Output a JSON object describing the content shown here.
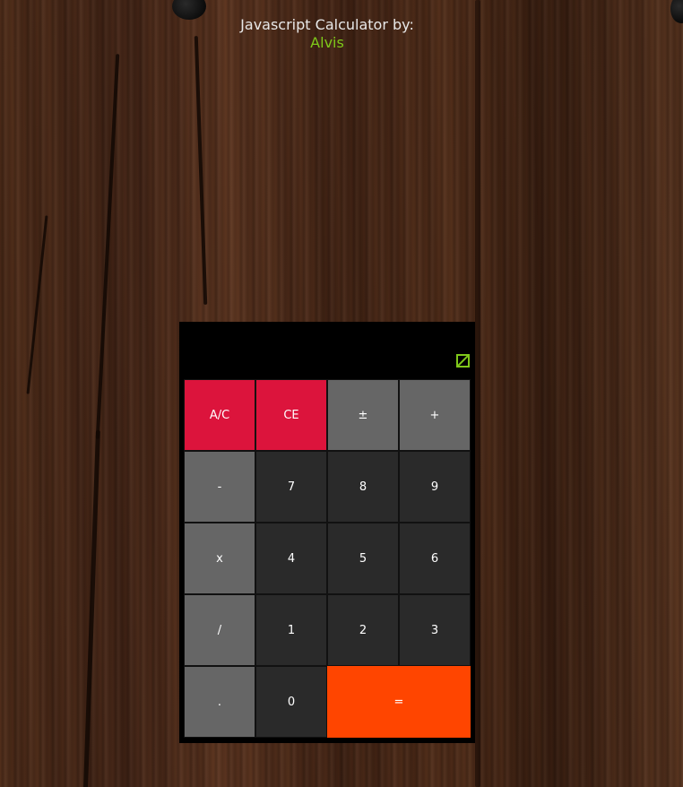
{
  "header": {
    "title": "Javascript Calculator by:",
    "author": "Alvis"
  },
  "display": {
    "value": ""
  },
  "colors": {
    "accent": "#7fc81a",
    "clear_keys": "#dc143c",
    "operator_keys": "#666666",
    "digit_keys": "#2a2a2a",
    "equals_key": "#ff4500"
  },
  "keys": {
    "ac": "A/C",
    "ce": "CE",
    "plus_minus": "±",
    "plus": "+",
    "minus": "-",
    "seven": "7",
    "eight": "8",
    "nine": "9",
    "multiply": "x",
    "four": "4",
    "five": "5",
    "six": "6",
    "divide": "/",
    "one": "1",
    "two": "2",
    "three": "3",
    "decimal": ".",
    "zero": "0",
    "equals": "="
  }
}
